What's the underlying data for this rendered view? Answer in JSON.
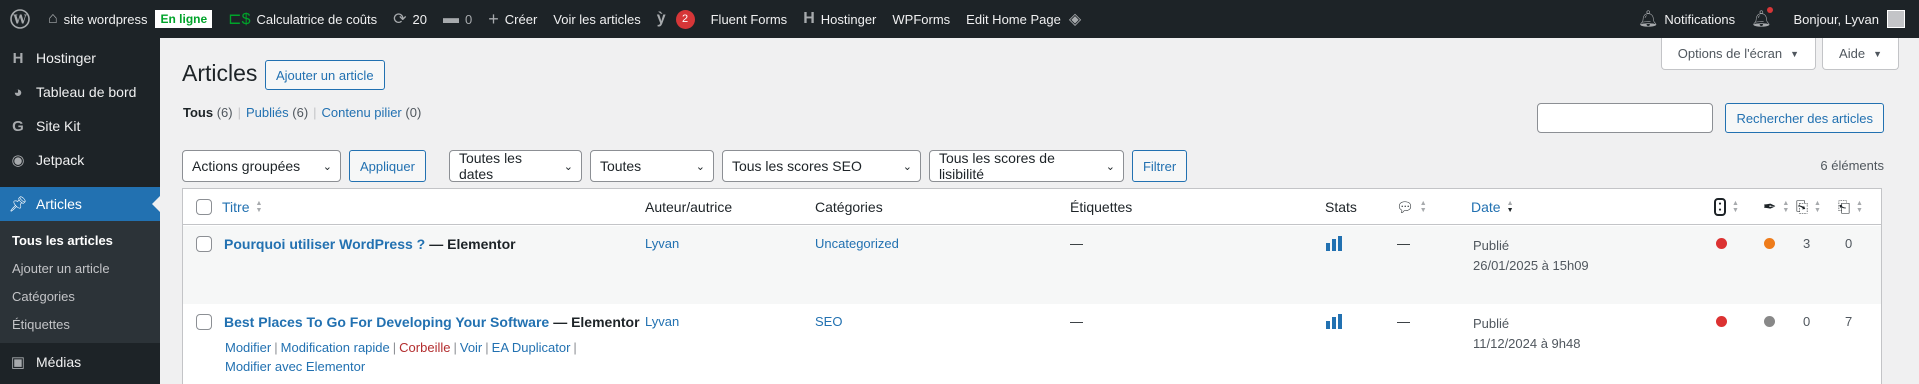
{
  "adminbar": {
    "site_name": "site wordpress",
    "online_badge": "En ligne",
    "calculator": "Calculatrice de coûts",
    "updates_count": "20",
    "comments_count": "0",
    "create": "Créer",
    "view_posts": "Voir les articles",
    "yoast_count": "2",
    "fluent_forms": "Fluent Forms",
    "hostinger": "Hostinger",
    "wpforms": "WPForms",
    "edit_home": "Edit Home Page",
    "notifications": "Notifications",
    "greeting": "Bonjour, Lyvan"
  },
  "sidebar": {
    "items": [
      {
        "label": "Hostinger",
        "icon": "hostinger-icon"
      },
      {
        "label": "Tableau de bord",
        "icon": "dashboard-icon"
      },
      {
        "label": "Site Kit",
        "icon": "google-icon"
      },
      {
        "label": "Jetpack",
        "icon": "jetpack-icon"
      },
      {
        "label": "Articles",
        "icon": "pin-icon"
      }
    ],
    "submenu": [
      "Tous les articles",
      "Ajouter un article",
      "Catégories",
      "Étiquettes"
    ],
    "next_item": "Médias"
  },
  "screen_options": "Options de l'écran",
  "help": "Aide",
  "page_title": "Articles",
  "add_new": "Ajouter un article",
  "views": {
    "all": "Tous",
    "all_count": "(6)",
    "published": "Publiés",
    "published_count": "(6)",
    "pillar": "Contenu pilier",
    "pillar_count": "(0)"
  },
  "search_button": "Rechercher des articles",
  "filters": {
    "bulk_actions": "Actions groupées",
    "apply": "Appliquer",
    "dates": "Toutes les dates",
    "all": "Toutes",
    "seo": "Tous les scores SEO",
    "readability": "Tous les scores de lisibilité",
    "filter": "Filtrer"
  },
  "items_count": "6 éléments",
  "table": {
    "headers": {
      "title": "Titre",
      "author": "Auteur/autrice",
      "categories": "Catégories",
      "tags": "Étiquettes",
      "stats": "Stats",
      "date": "Date"
    },
    "rows": [
      {
        "title": "Pourquoi utiliser WordPress ?",
        "suffix": "— Elementor",
        "author": "Lyvan",
        "category": "Uncategorized",
        "tags": "—",
        "comments": "—",
        "status": "Publié",
        "date": "26/01/2025 à 15h09",
        "seo_color": "#dc3232",
        "read_color": "#ee7c1b",
        "links_out": "3",
        "links_in": "0"
      },
      {
        "title": "Best Places To Go For Developing Your Software",
        "suffix": "— Elementor",
        "author": "Lyvan",
        "category": "SEO",
        "tags": "—",
        "comments": "—",
        "status": "Publié",
        "date": "11/12/2024 à 9h48",
        "seo_color": "#dc3232",
        "read_color": "#888888",
        "links_out": "0",
        "links_in": "7"
      }
    ],
    "row_actions": {
      "edit": "Modifier",
      "quick_edit": "Modification rapide",
      "trash": "Corbeille",
      "view": "Voir",
      "duplicate": "EA Duplicator",
      "elementor": "Modifier avec Elementor"
    }
  }
}
